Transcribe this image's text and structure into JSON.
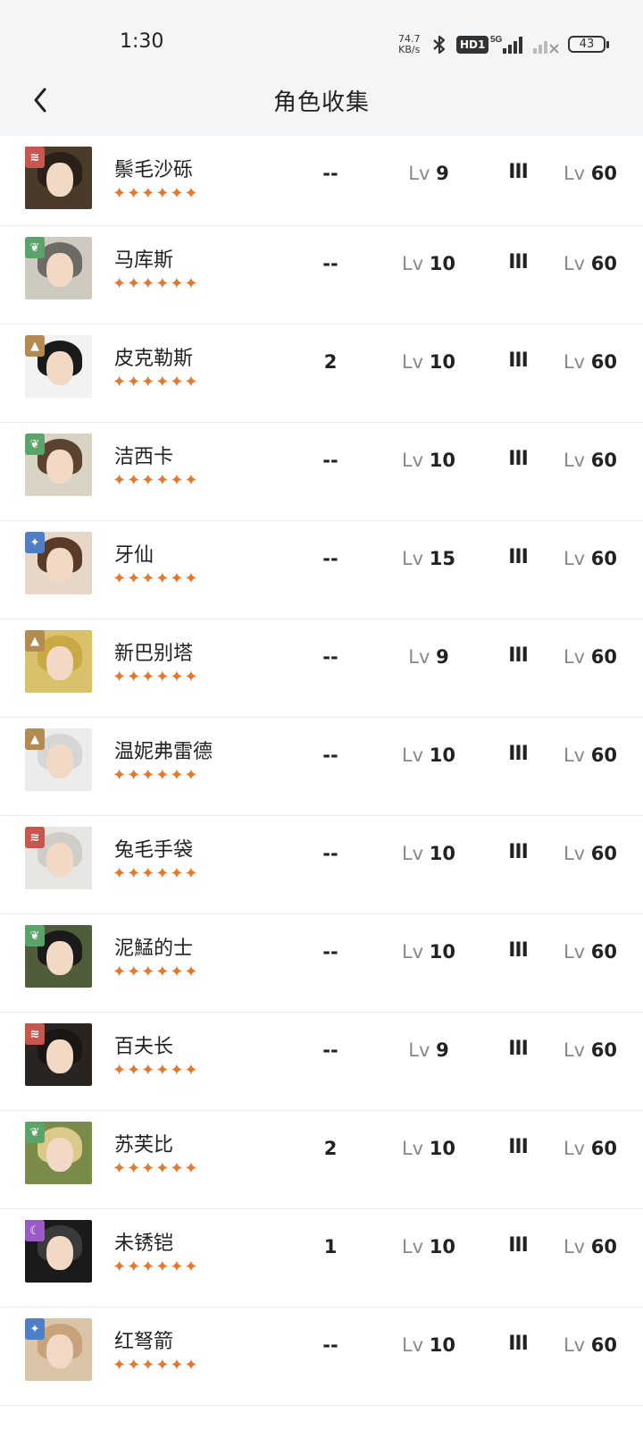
{
  "status": {
    "time": "1:30",
    "net_speed_value": "74.7",
    "net_speed_unit": "KB/s",
    "hd_label": "HD1",
    "network": "5G",
    "battery": "43"
  },
  "nav": {
    "title": "角色收集"
  },
  "rows": [
    {
      "name": "鬃毛沙砾",
      "stars": "✦✦✦✦✦✦",
      "value": "--",
      "lv_prefix": "Lv",
      "level": "9",
      "rank": "III",
      "max_prefix": "Lv",
      "max_level": "60",
      "element": "beast",
      "element_color": "#c9554f",
      "bg_color": "#4a3a2a",
      "hair_color": "#2b2019"
    },
    {
      "name": "马库斯",
      "stars": "✦✦✦✦✦✦",
      "value": "--",
      "lv_prefix": "Lv",
      "level": "10",
      "rank": "III",
      "max_prefix": "Lv",
      "max_level": "60",
      "element": "plant",
      "element_color": "#5aa36b",
      "bg_color": "#cfcac0",
      "hair_color": "#6e6a66"
    },
    {
      "name": "皮克勒斯",
      "stars": "✦✦✦✦✦✦",
      "value": "2",
      "lv_prefix": "Lv",
      "level": "10",
      "rank": "III",
      "max_prefix": "Lv",
      "max_level": "60",
      "element": "mineral",
      "element_color": "#b38a4f",
      "bg_color": "#f2f2f2",
      "hair_color": "#1a1a1a"
    },
    {
      "name": "洁西卡",
      "stars": "✦✦✦✦✦✦",
      "value": "--",
      "lv_prefix": "Lv",
      "level": "10",
      "rank": "III",
      "max_prefix": "Lv",
      "max_level": "60",
      "element": "plant",
      "element_color": "#5aa36b",
      "bg_color": "#d9d3c5",
      "hair_color": "#5a4330"
    },
    {
      "name": "牙仙",
      "stars": "✦✦✦✦✦✦",
      "value": "--",
      "lv_prefix": "Lv",
      "level": "15",
      "rank": "III",
      "max_prefix": "Lv",
      "max_level": "60",
      "element": "star",
      "element_color": "#4f7ec9",
      "bg_color": "#e6d7c9",
      "hair_color": "#5a3a28"
    },
    {
      "name": "新巴别塔",
      "stars": "✦✦✦✦✦✦",
      "value": "--",
      "lv_prefix": "Lv",
      "level": "9",
      "rank": "III",
      "max_prefix": "Lv",
      "max_level": "60",
      "element": "mineral",
      "element_color": "#b38a4f",
      "bg_color": "#d8c16a",
      "hair_color": "#c9a944"
    },
    {
      "name": "温妮弗雷德",
      "stars": "✦✦✦✦✦✦",
      "value": "--",
      "lv_prefix": "Lv",
      "level": "10",
      "rank": "III",
      "max_prefix": "Lv",
      "max_level": "60",
      "element": "mineral",
      "element_color": "#b38a4f",
      "bg_color": "#ececec",
      "hair_color": "#d6d6d6"
    },
    {
      "name": "兔毛手袋",
      "stars": "✦✦✦✦✦✦",
      "value": "--",
      "lv_prefix": "Lv",
      "level": "10",
      "rank": "III",
      "max_prefix": "Lv",
      "max_level": "60",
      "element": "beast",
      "element_color": "#c9554f",
      "bg_color": "#e8e6e2",
      "hair_color": "#cfcdc8"
    },
    {
      "name": "泥鯭的士",
      "stars": "✦✦✦✦✦✦",
      "value": "--",
      "lv_prefix": "Lv",
      "level": "10",
      "rank": "III",
      "max_prefix": "Lv",
      "max_level": "60",
      "element": "plant",
      "element_color": "#5aa36b",
      "bg_color": "#4f5d3a",
      "hair_color": "#1a1a1a"
    },
    {
      "name": "百夫长",
      "stars": "✦✦✦✦✦✦",
      "value": "--",
      "lv_prefix": "Lv",
      "level": "9",
      "rank": "III",
      "max_prefix": "Lv",
      "max_level": "60",
      "element": "beast",
      "element_color": "#c9554f",
      "bg_color": "#2a2420",
      "hair_color": "#1a1614"
    },
    {
      "name": "苏芙比",
      "stars": "✦✦✦✦✦✦",
      "value": "2",
      "lv_prefix": "Lv",
      "level": "10",
      "rank": "III",
      "max_prefix": "Lv",
      "max_level": "60",
      "element": "plant",
      "element_color": "#5aa36b",
      "bg_color": "#7a8a48",
      "hair_color": "#d9c98a"
    },
    {
      "name": "未锈铠",
      "stars": "✦✦✦✦✦✦",
      "value": "1",
      "lv_prefix": "Lv",
      "level": "10",
      "rank": "III",
      "max_prefix": "Lv",
      "max_level": "60",
      "element": "spirit",
      "element_color": "#9a5bc4",
      "bg_color": "#1a1a1a",
      "hair_color": "#3a3a3a"
    },
    {
      "name": "红弩箭",
      "stars": "✦✦✦✦✦✦",
      "value": "--",
      "lv_prefix": "Lv",
      "level": "10",
      "rank": "III",
      "max_prefix": "Lv",
      "max_level": "60",
      "element": "star",
      "element_color": "#4f7ec9",
      "bg_color": "#d9c4a8",
      "hair_color": "#c7a27a"
    }
  ]
}
